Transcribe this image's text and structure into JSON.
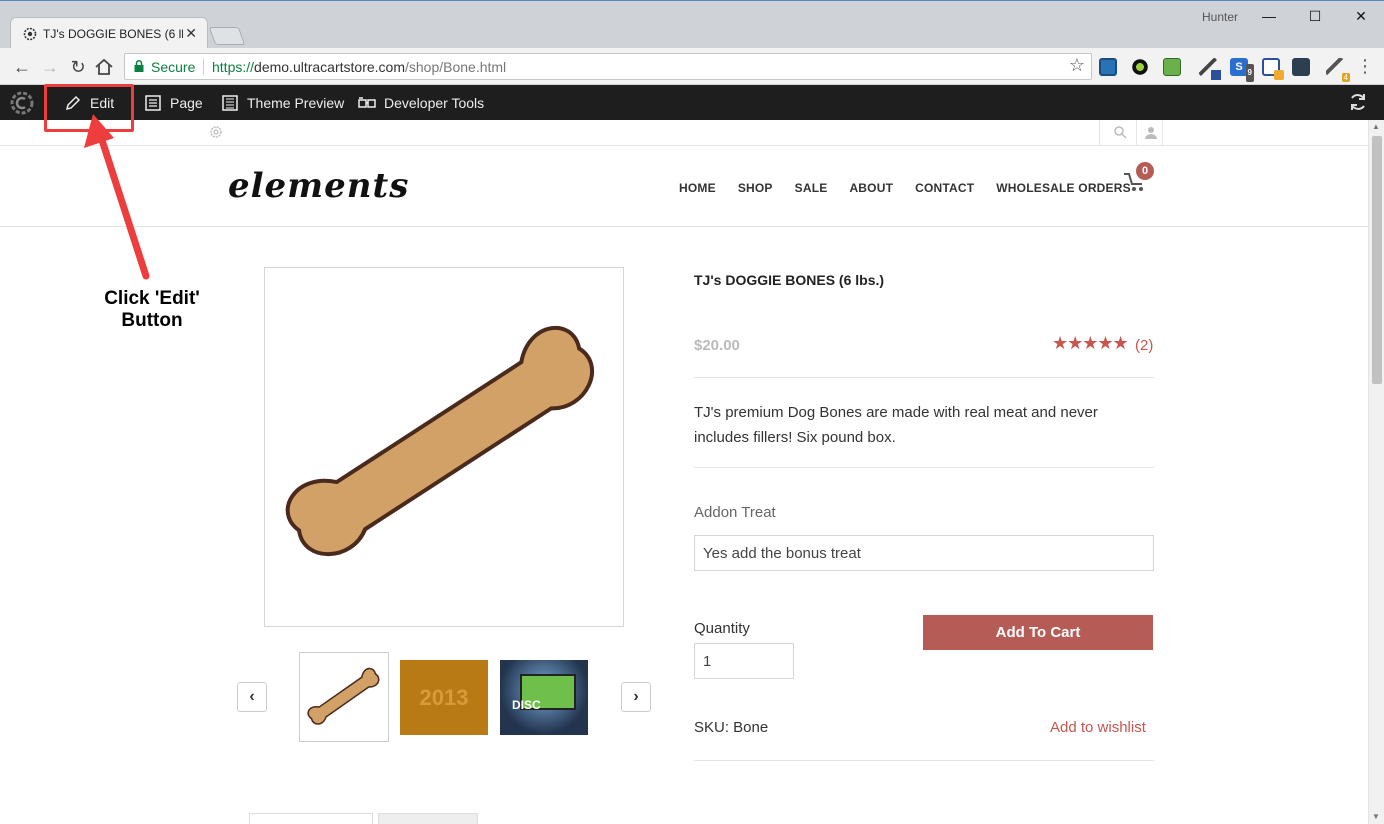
{
  "browser": {
    "tab_title": "TJ's DOGGIE BONES (6 lbs.)",
    "profile_name": "Hunter",
    "secure_label": "Secure",
    "url_scheme": "https://",
    "url_host": "demo.ultracartstore.com",
    "url_path": "/shop/Bone.html",
    "extension_badges": [
      "9",
      "4"
    ]
  },
  "adminbar": {
    "edit_label": "Edit",
    "page_label": "Page",
    "theme_preview_label": "Theme Preview",
    "developer_tools_label": "Developer Tools"
  },
  "header": {
    "logo": "elements",
    "nav": [
      "HOME",
      "SHOP",
      "SALE",
      "ABOUT",
      "CONTACT",
      "WHOLESALE ORDERS"
    ],
    "cart_count": "0"
  },
  "product": {
    "title": "TJ's DOGGIE BONES (6 lbs.)",
    "price": "$20.00",
    "rating_stars": 5,
    "review_count": "(2)",
    "description": "TJ's premium Dog Bones are made with real meat and never includes fillers! Six pound box.",
    "addon_label": "Addon Treat",
    "addon_value": "Yes add the bonus treat",
    "quantity_label": "Quantity",
    "quantity_value": "1",
    "add_to_cart_label": "Add To Cart",
    "sku": "SKU: Bone",
    "wishlist_label": "Add to wishlist",
    "thumbnail_2013": "2013",
    "thumbnail_laptop_text": "DISC"
  },
  "annotation": {
    "callout_text": "Click 'Edit' Button",
    "color": "#ee3d3d"
  },
  "colors": {
    "accent": "#b65c56",
    "admin_bar": "#1e1e1e",
    "secure_green": "#0b8043"
  }
}
